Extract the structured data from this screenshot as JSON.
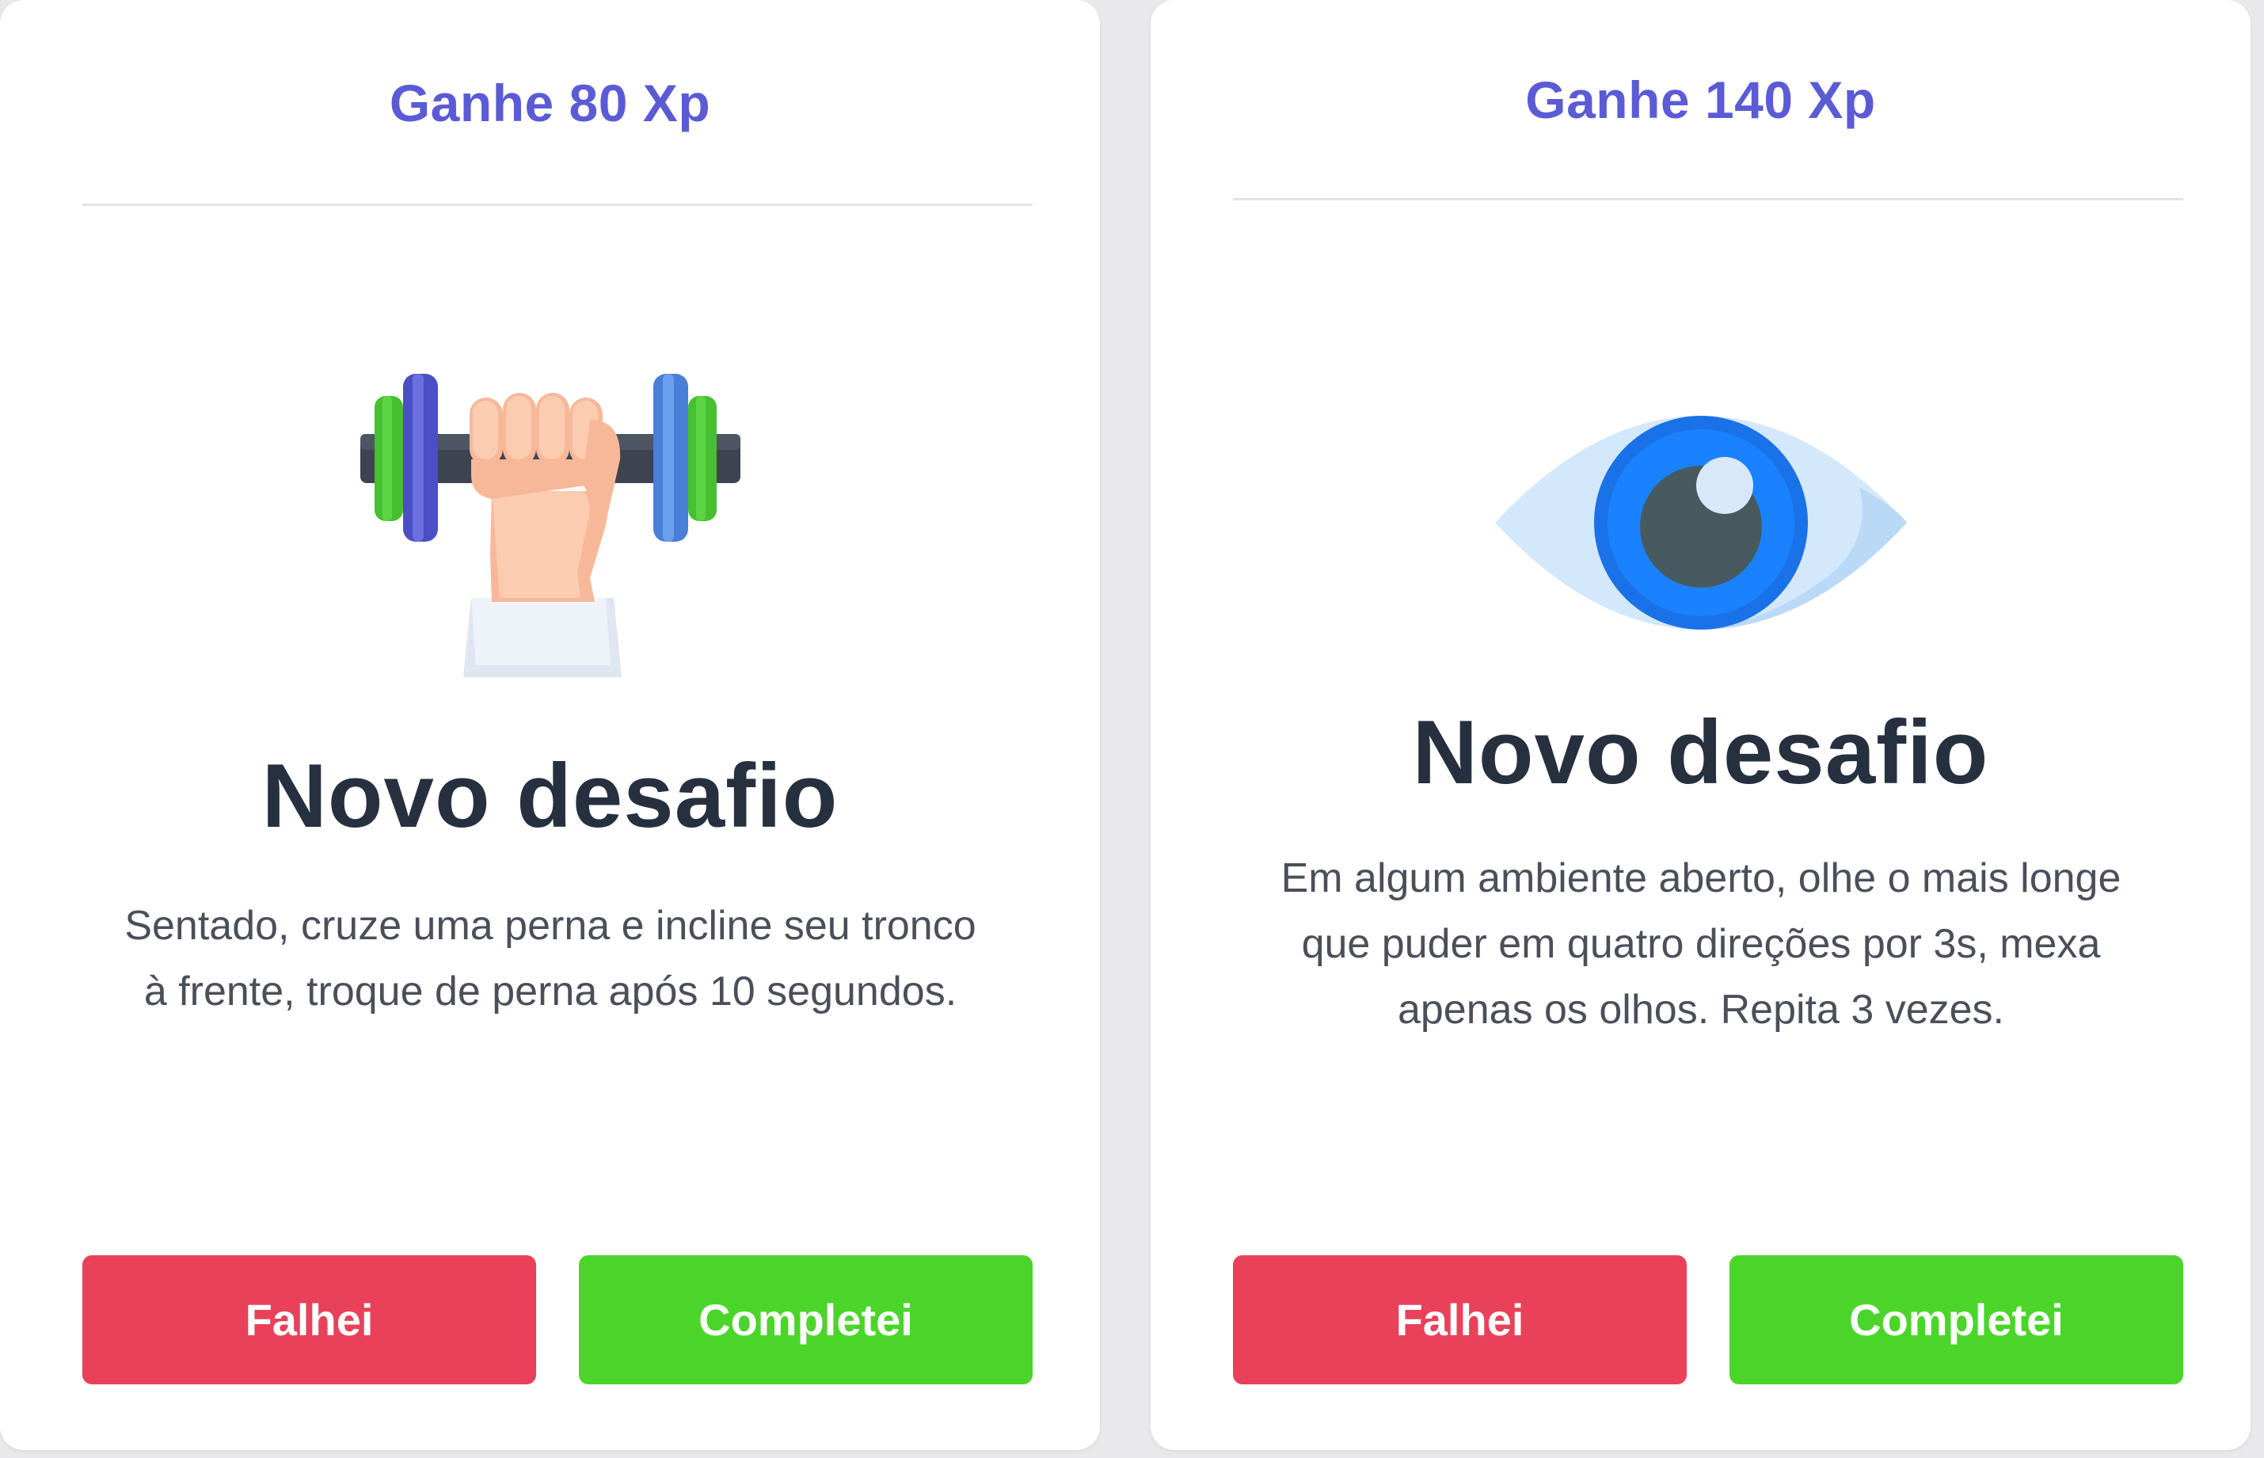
{
  "cards": [
    {
      "xp_label": "Ganhe 80 Xp",
      "icon": "dumbbell-icon",
      "title": "Novo desafio",
      "description": "Sentado, cruze uma perna e incline seu tronco à frente, troque de perna após 10 segundos.",
      "fail_label": "Falhei",
      "complete_label": "Completei"
    },
    {
      "xp_label": "Ganhe 140 Xp",
      "icon": "eye-icon",
      "title": "Novo desafio",
      "description": "Em algum ambiente aberto, olhe o mais longe que puder em quatro direções por 3s, mexa apenas os olhos. Repita 3 vezes.",
      "fail_label": "Falhei",
      "complete_label": "Completei"
    }
  ],
  "colors": {
    "accent": "#5b5bd6",
    "fail": "#e84159",
    "complete": "#4bd52a",
    "title": "#27303f",
    "text": "#4a4f5a"
  }
}
